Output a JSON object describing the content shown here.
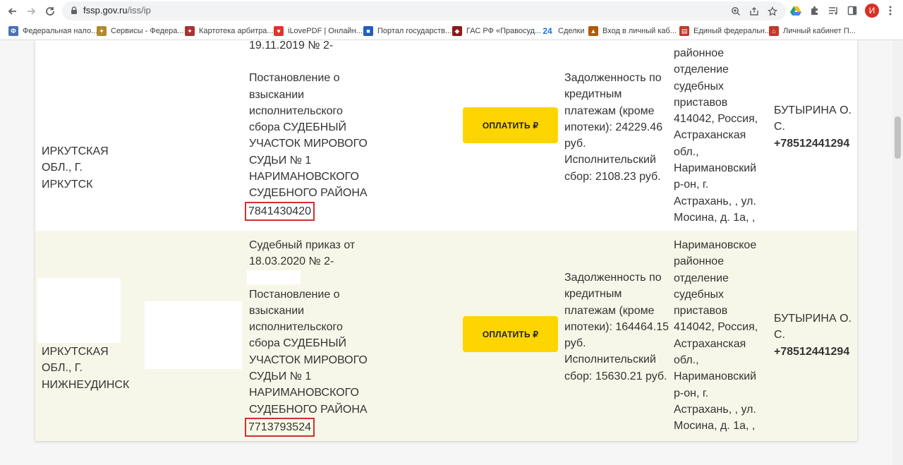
{
  "browser": {
    "url_host": "fssp.gov.ru",
    "url_path": "/iss/ip",
    "profile_initial": "И",
    "bookmarks": [
      {
        "label": "Федеральная нало...",
        "icon": "tax-service-icon",
        "color": "#4a72b5"
      },
      {
        "label": "Сервисы - Федера...",
        "icon": "eagle-emblem-icon",
        "color": "#b08a2e"
      },
      {
        "label": "Картотека арбитра...",
        "icon": "eagle-emblem-icon",
        "color": "#a33"
      },
      {
        "label": "iLovePDF | Онлайн...",
        "icon": "heart-icon",
        "color": "#e5322d"
      },
      {
        "label": "Портал государств...",
        "icon": "flag-icon",
        "color": "#1f5fbf"
      },
      {
        "label": "ГАС РФ «Правосуд...",
        "icon": "emblem-icon",
        "color": "#8b1a1a"
      },
      {
        "label": "Сделки",
        "icon": "number-24-icon",
        "color": "#1a73e8"
      },
      {
        "label": "Вход в личный каб...",
        "icon": "triangle-icon",
        "color": "#b05a00"
      },
      {
        "label": "Единый федеральн...",
        "icon": "document-icon",
        "color": "#c0392b"
      },
      {
        "label": "Личный кабинет П...",
        "icon": "building-icon",
        "color": "#c0392b"
      }
    ]
  },
  "rows": [
    {
      "region": "ИРКУТСКАЯ ОБЛ., Г. ИРКУТСК",
      "docs_top": "19.11.2019 № 2-",
      "docs_main": "Постановление о взыскании исполнительского сбора СУДЕБНЫЙ УЧАСТОК МИРОВОГО СУДЬИ № 1 НАРИМАНОВСКОГО СУДЕБНОГО РАЙОНА",
      "inn": "7841430420",
      "pay_label": "ОПЛАТИТЬ ₽",
      "debt": "Задолженность по кредитным платежам (кроме ипотеки): 24229.46 руб. Исполнительский сбор: 2108.23 руб.",
      "department": "районное отделение судебных приставов 414042, Россия, Астраханская обл., Наримановский р-он, г. Астрахань, , ул. Мосина, д. 1а, ,",
      "bailiff": "БУТЫРИНА О. С.",
      "phone": "+78512441294"
    },
    {
      "region": "ИРКУТСКАЯ ОБЛ., Г. НИЖНЕУДИНСК",
      "docs_top": "Судебный приказ от 18.03.2020 № 2-",
      "docs_main": "Постановление о взыскании исполнительского сбора СУДЕБНЫЙ УЧАСТОК МИРОВОГО СУДЬИ № 1 НАРИМАНОВСКОГО СУДЕБНОГО РАЙОНА",
      "inn": "7713793524",
      "pay_label": "ОПЛАТИТЬ ₽",
      "debt": "Задолженность по кредитным платежам (кроме ипотеки): 164464.15 руб. Исполнительский сбор: 15630.21 руб.",
      "department": "Наримановское районное отделение судебных приставов 414042, Россия, Астраханская обл., Наримановский р-он, г. Астрахань, , ул. Мосина, д. 1а, ,",
      "bailiff": "БУТЫРИНА О. С.",
      "phone": "+78512441294"
    }
  ]
}
